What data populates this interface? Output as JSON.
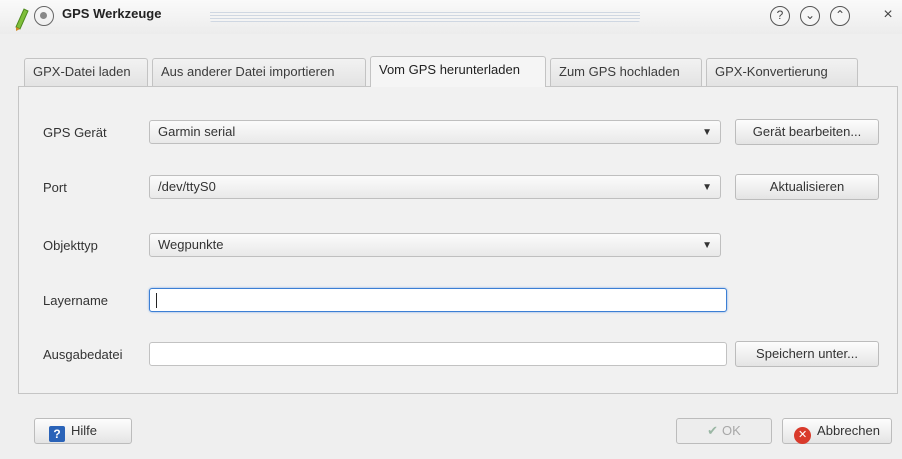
{
  "window": {
    "title": "GPS Werkzeuge",
    "controls": {
      "help": "?",
      "minimize": "⌄",
      "maximize": "⌃",
      "close": "×"
    }
  },
  "tabs": [
    {
      "label": "GPX-Datei laden",
      "active": false
    },
    {
      "label": "Aus anderer Datei importieren",
      "active": false
    },
    {
      "label": "Vom GPS herunterladen",
      "active": true
    },
    {
      "label": "Zum GPS hochladen",
      "active": false
    },
    {
      "label": "GPX-Konvertierung",
      "active": false
    }
  ],
  "form": {
    "gps_device": {
      "label": "GPS Gerät",
      "value": "Garmin serial",
      "button": "Gerät bearbeiten..."
    },
    "port": {
      "label": "Port",
      "value": "/dev/ttyS0",
      "button": "Aktualisieren"
    },
    "object_type": {
      "label": "Objekttyp",
      "value": "Wegpunkte"
    },
    "layer_name": {
      "label": "Layername",
      "value": ""
    },
    "output_file": {
      "label": "Ausgabedatei",
      "value": "",
      "button": "Speichern unter..."
    }
  },
  "footer": {
    "help_label": "Hilfe",
    "ok_label": "OK",
    "cancel_label": "Abbrechen"
  },
  "icons": {
    "app": "pencil-icon",
    "window": "window-menu-icon",
    "help": "help-icon",
    "ok": "checkmark-icon",
    "cancel": "cancel-icon",
    "dropdown": "chevron-down-icon"
  },
  "colors": {
    "focus": "#3c7fd4",
    "cancel": "#d93a2b",
    "help": "#2a63b8"
  }
}
